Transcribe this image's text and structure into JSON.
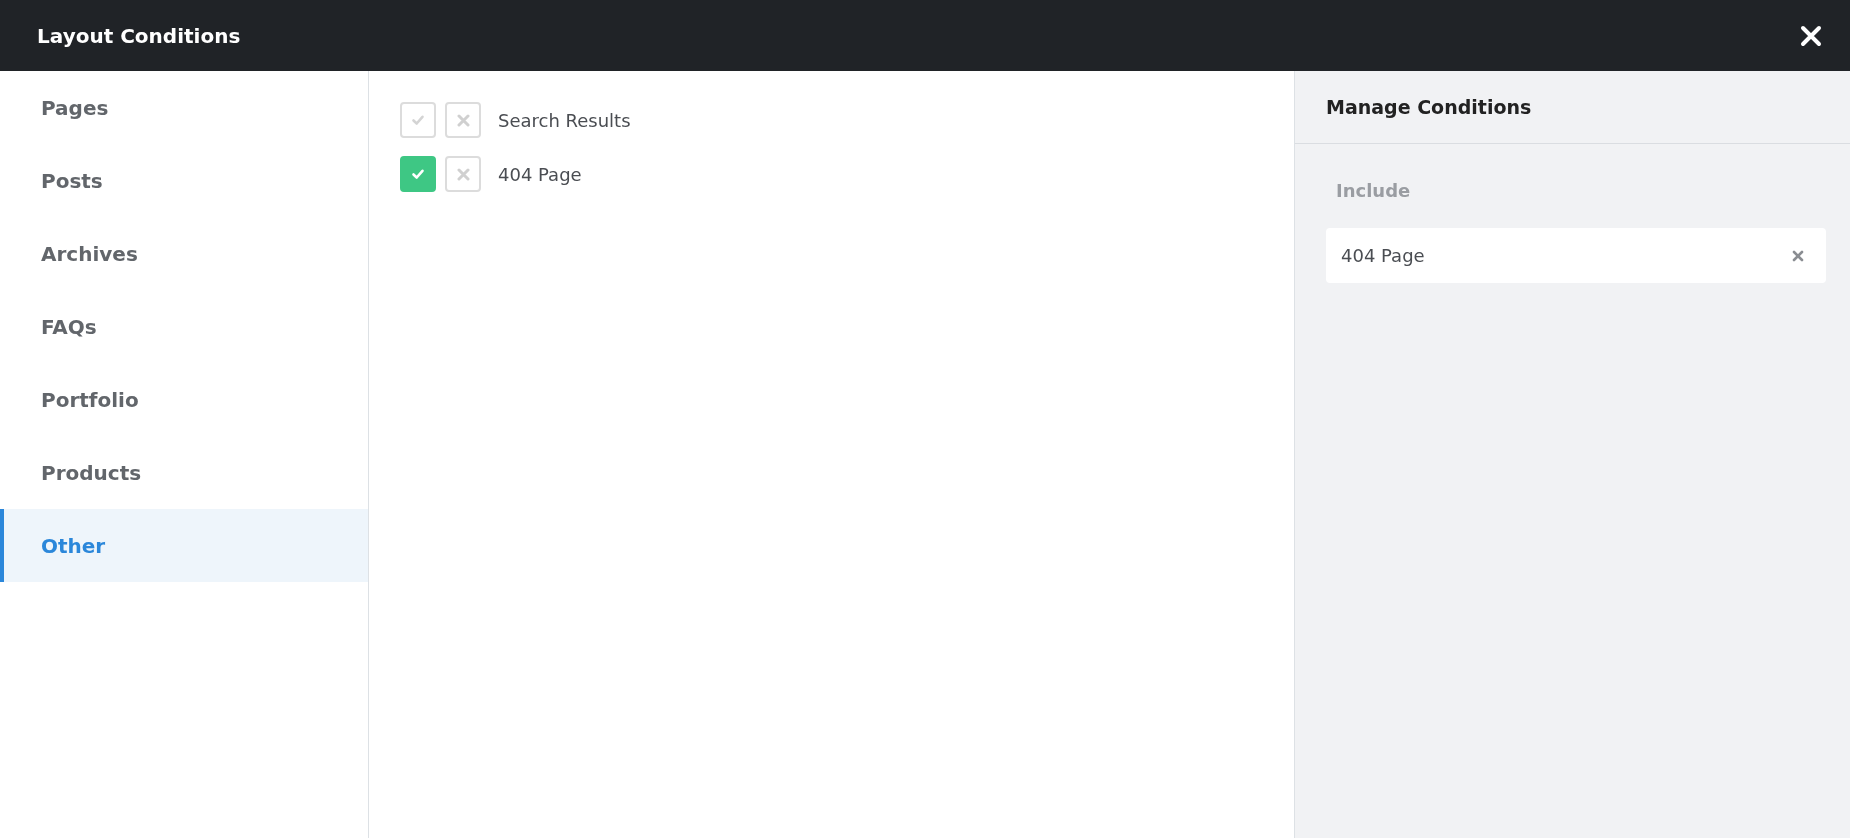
{
  "window": {
    "title": "Layout Conditions"
  },
  "sidebar": {
    "items": [
      {
        "label": "Pages",
        "selected": false
      },
      {
        "label": "Posts",
        "selected": false
      },
      {
        "label": "Archives",
        "selected": false
      },
      {
        "label": "FAQs",
        "selected": false
      },
      {
        "label": "Portfolio",
        "selected": false
      },
      {
        "label": "Products",
        "selected": false
      },
      {
        "label": "Other",
        "selected": true
      }
    ]
  },
  "conditions": [
    {
      "label": "Search Results",
      "included": false,
      "excluded": false
    },
    {
      "label": "404 Page",
      "included": true,
      "excluded": false
    }
  ],
  "manage_panel": {
    "title": "Manage Conditions",
    "section_label": "Include",
    "items": [
      {
        "label": "404 Page"
      }
    ]
  }
}
